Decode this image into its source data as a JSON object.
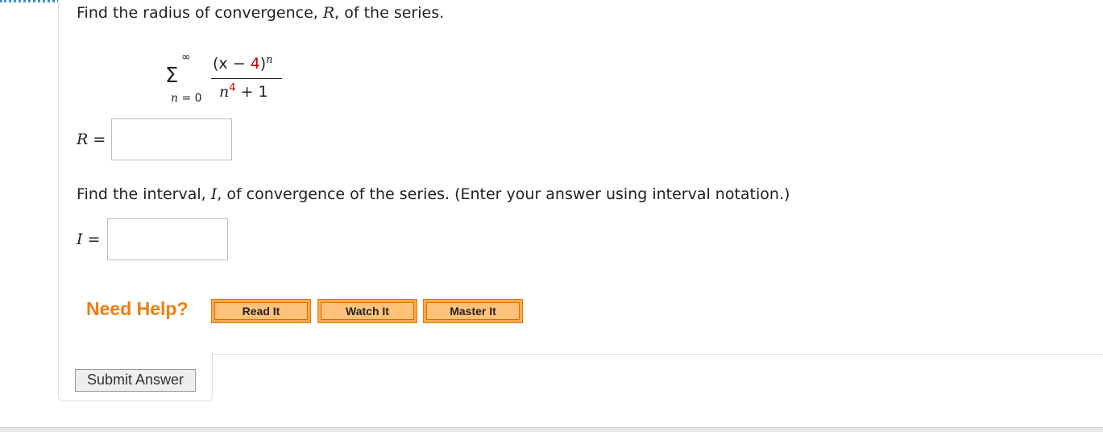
{
  "question1": {
    "text_before": "Find the radius of convergence, ",
    "var": "R",
    "text_after": ", of the series."
  },
  "series": {
    "sum_symbol": "Σ",
    "upper_limit": "∞",
    "lower_limit_var": "n",
    "lower_limit_rest": " = 0",
    "numerator_open": "(x − ",
    "numerator_const": "4",
    "numerator_close": ")",
    "numerator_exp": "n",
    "denominator_base": "n",
    "denominator_exp": "4",
    "denominator_rest": " + 1"
  },
  "answer_r": {
    "label_var": "R",
    "label_eq": " =",
    "value": ""
  },
  "question2": {
    "text_before": "Find the interval, ",
    "var": "I",
    "text_after": ", of convergence of the series. (Enter your answer using interval notation.)"
  },
  "answer_i": {
    "label_var": "I",
    "label_eq": " =",
    "value": ""
  },
  "help": {
    "title": "Need Help?",
    "buttons": [
      "Read It",
      "Watch It",
      "Master It"
    ]
  },
  "submit_label": "Submit Answer",
  "colors": {
    "accent_orange": "#f07c10",
    "red_math": "#cc0000",
    "dotted_border": "#3f8fd0"
  }
}
